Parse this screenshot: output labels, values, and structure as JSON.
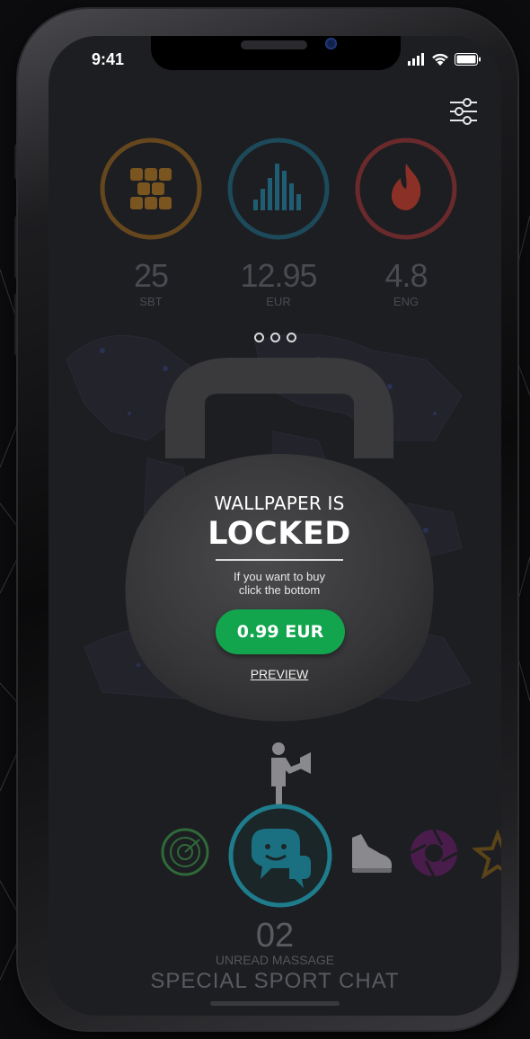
{
  "status_bar": {
    "time": "9:41"
  },
  "stats": [
    {
      "value": "25",
      "unit": "SBT",
      "color": "#c8812a"
    },
    {
      "value": "12.95",
      "unit": "EUR",
      "color": "#2c8ca8"
    },
    {
      "value": "4.8",
      "unit": "ENG",
      "color": "#c2403d"
    }
  ],
  "carousel": {
    "page_indicator": "more-dots-icon"
  },
  "lock_card": {
    "line1": "WALLPAPER IS",
    "line2": "LOCKED",
    "subtitle_line1": "If you want to buy",
    "subtitle_line2": "click the bottom",
    "buy_label": "0.99 EUR",
    "preview_label": "PREVIEW"
  },
  "bottom_nav": {
    "icons": [
      "radar-icon",
      "chat-icon",
      "sneaker-icon",
      "shutter-icon",
      "star-icon"
    ],
    "count": "02",
    "unread_label": "UNREAD MASSAGE",
    "title": "SPECIAL SPORT CHAT"
  },
  "colors": {
    "green": "#12a54e",
    "chat_blue": "#1e7c8c",
    "orange": "#c8812a",
    "blue": "#2c8ca8",
    "red": "#c2403d",
    "purple": "#8a2f8c",
    "radar_green": "#2f6a3a"
  }
}
